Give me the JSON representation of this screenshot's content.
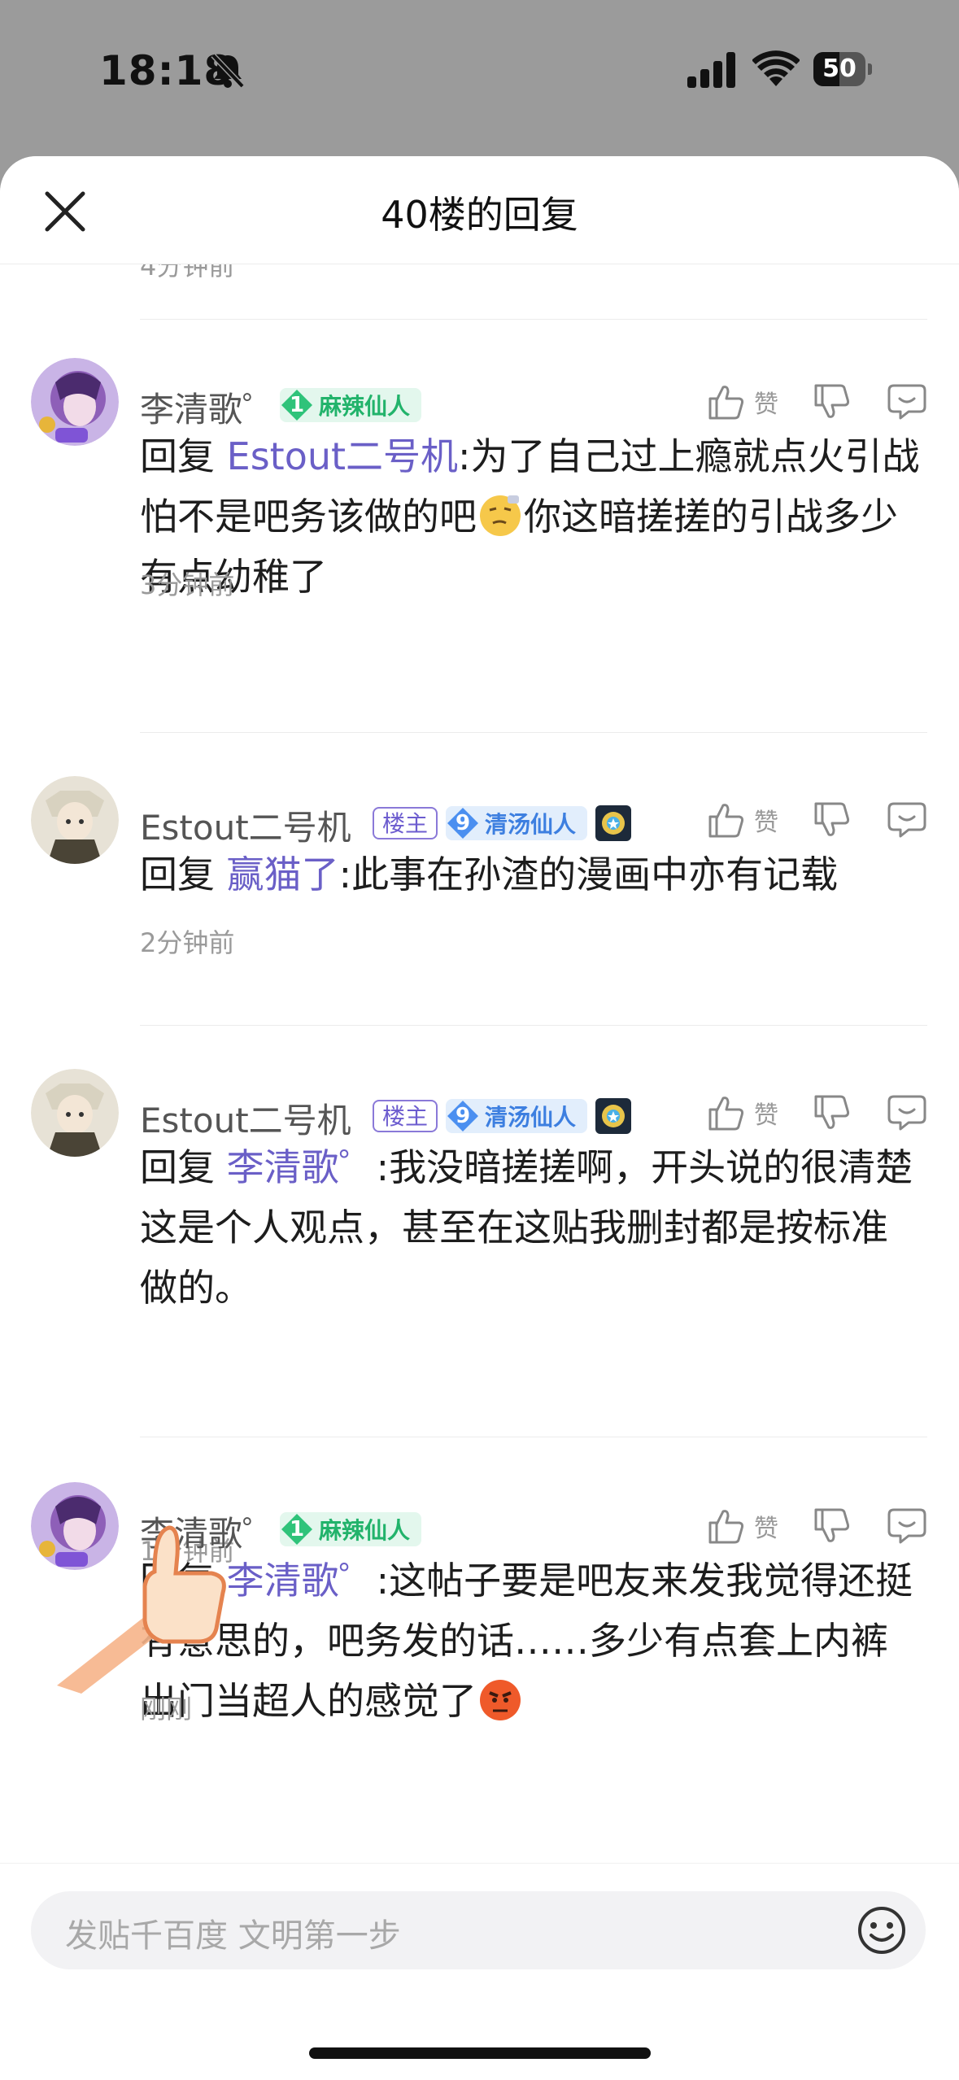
{
  "status": {
    "time": "18:18",
    "battery": "50"
  },
  "sheet": {
    "title": "40楼的回复"
  },
  "previous_time": "4分钟前",
  "comments": [
    {
      "name": "李清歌゜",
      "level": "1",
      "tag": "麻辣仙人",
      "like_label": "赞",
      "reply_word": "回复",
      "mention": "Estout二号机",
      "text_a": ":为了自己过上瘾就点火引战怕不是吧务该做的吧",
      "text_b": "你这暗搓搓的引战多少有点幼稚了",
      "time": "3分钟前"
    },
    {
      "name": "Estout二号机",
      "owner_tag": "楼主",
      "level": "9",
      "tag": "清汤仙人",
      "like_label": "赞",
      "reply_word": "回复",
      "mention": "赢猫了",
      "text_a": ":此事在孙渣的漫画中亦有记载",
      "time": "2分钟前"
    },
    {
      "name": "Estout二号机",
      "owner_tag": "楼主",
      "level": "9",
      "tag": "清汤仙人",
      "like_label": "赞",
      "reply_word": "回复",
      "mention": "李清歌゜",
      "text_a": ":我没暗搓搓啊，开头说的很清楚这是个人观点，甚至在这贴我删封都是按标准做的。",
      "time": "1分钟前"
    },
    {
      "name": "李清歌゜",
      "level": "1",
      "tag": "麻辣仙人",
      "like_label": "赞",
      "reply_word": "回复",
      "mention": "李清歌゜",
      "text_a": ":这帖子要是吧友来发我觉得还挺有意思的，吧务发的话……多少有点套上内裤出门当超人的感觉了",
      "time": "刚刚"
    }
  ],
  "input": {
    "placeholder": "发贴千百度 文明第一步"
  }
}
